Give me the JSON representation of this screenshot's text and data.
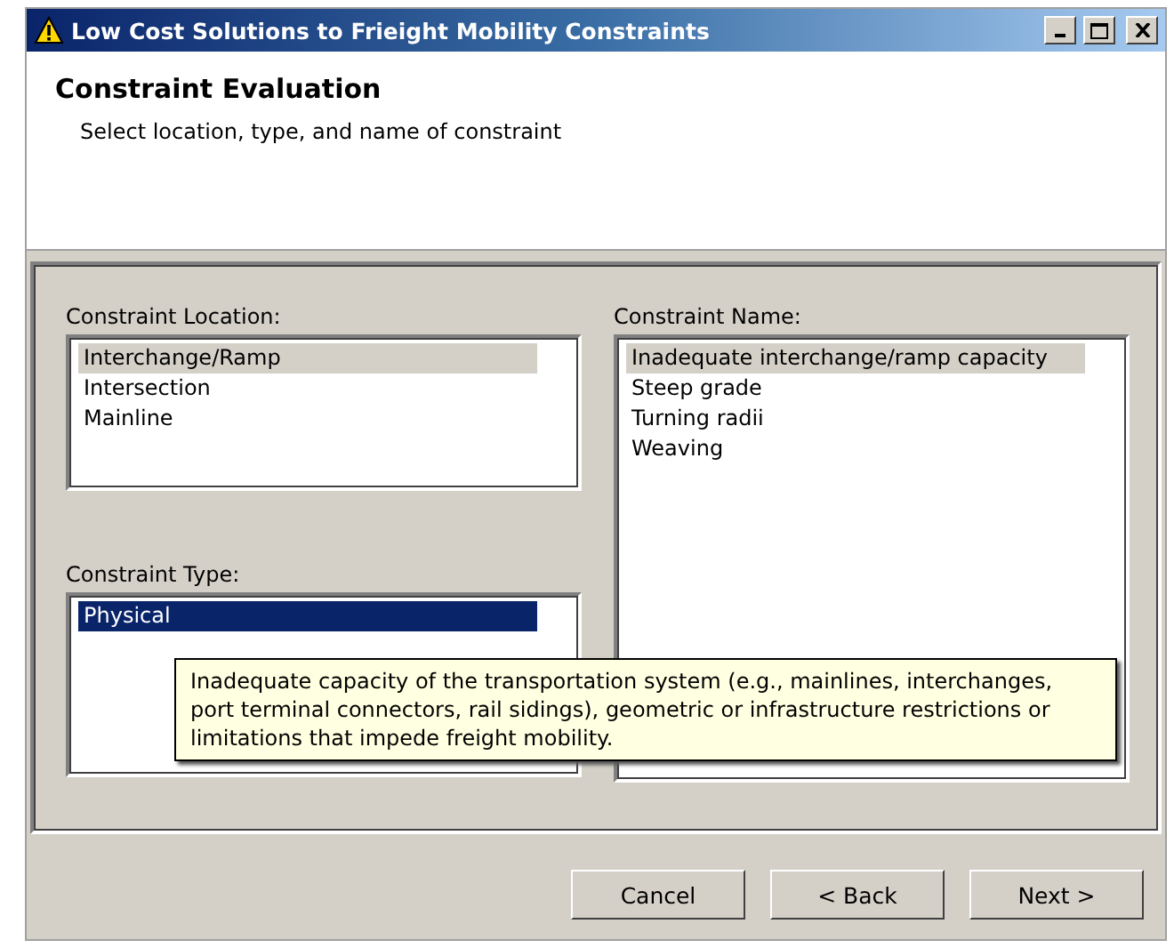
{
  "window": {
    "title": "Low Cost Solutions to Frieight Mobility Constraints"
  },
  "header": {
    "title": "Constraint Evaluation",
    "subtitle": "Select location, type, and name of constraint"
  },
  "location": {
    "label": "Constraint Location:",
    "focused": false,
    "items": [
      {
        "text": "Interchange/Ramp",
        "selected": true
      },
      {
        "text": "Intersection",
        "selected": false
      },
      {
        "text": "Mainline",
        "selected": false
      }
    ]
  },
  "type": {
    "label": "Constraint Type:",
    "focused": true,
    "items": [
      {
        "text": "Physical",
        "selected": true
      }
    ]
  },
  "name": {
    "label": "Constraint Name:",
    "focused": false,
    "items": [
      {
        "text": "Inadequate interchange/ramp capacity",
        "selected": true
      },
      {
        "text": "Steep grade",
        "selected": false
      },
      {
        "text": "Turning radii",
        "selected": false
      },
      {
        "text": "Weaving",
        "selected": false
      }
    ]
  },
  "tooltip": "Inadequate capacity of the transportation system (e.g., mainlines, interchanges, port terminal connectors, rail sidings), geometric or infrastructure restrictions or limitations that impede freight mobility.",
  "buttons": [
    "Cancel",
    "< Back",
    "Next >"
  ]
}
